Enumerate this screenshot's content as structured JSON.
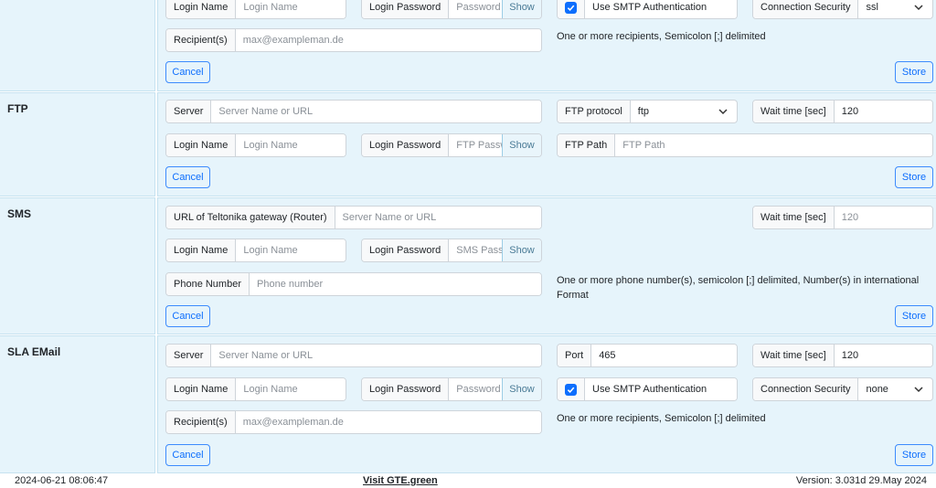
{
  "smtp": {
    "login_name": {
      "label": "Login Name",
      "placeholder": "Login Name"
    },
    "login_password": {
      "label": "Login Password",
      "placeholder": "Password",
      "show": "Show"
    },
    "auth": {
      "label": "Use SMTP Authentication",
      "checked": true
    },
    "security": {
      "label": "Connection Security",
      "value": "ssl"
    },
    "recipients": {
      "label": "Recipient(s)",
      "placeholder": "max@exampleman.de"
    },
    "hint": "One or more recipients, Semicolon [;] delimited",
    "cancel": "Cancel",
    "store": "Store"
  },
  "ftp": {
    "title": "FTP",
    "server": {
      "label": "Server",
      "placeholder": "Server Name or URL"
    },
    "protocol": {
      "label": "FTP protocol",
      "value": "ftp"
    },
    "wait": {
      "label": "Wait time [sec]",
      "value": "120"
    },
    "login_name": {
      "label": "Login Name",
      "placeholder": "Login Name"
    },
    "login_password": {
      "label": "Login Password",
      "placeholder": "FTP Passw",
      "show": "Show"
    },
    "path": {
      "label": "FTP Path",
      "placeholder": "FTP Path"
    },
    "cancel": "Cancel",
    "store": "Store"
  },
  "sms": {
    "title": "SMS",
    "gateway": {
      "label": "URL of Teltonika gateway (Router)",
      "placeholder": "Server Name or URL"
    },
    "wait": {
      "label": "Wait time [sec]",
      "placeholder": "120"
    },
    "login_name": {
      "label": "Login Name",
      "placeholder": "Login Name"
    },
    "login_password": {
      "label": "Login Password",
      "placeholder": "SMS Passv",
      "show": "Show"
    },
    "phone": {
      "label": "Phone Number",
      "placeholder": "Phone number"
    },
    "hint": "One or more phone number(s), semicolon [;] delimited, Number(s) in international Format",
    "cancel": "Cancel",
    "store": "Store"
  },
  "sla": {
    "title": "SLA EMail",
    "server": {
      "label": "Server",
      "placeholder": "Server Name or URL"
    },
    "port": {
      "label": "Port",
      "value": "465"
    },
    "wait": {
      "label": "Wait time [sec]",
      "value": "120"
    },
    "login_name": {
      "label": "Login Name",
      "placeholder": "Login Name"
    },
    "login_password": {
      "label": "Login Password",
      "placeholder": "Password",
      "show": "Show"
    },
    "auth": {
      "label": "Use SMTP Authentication",
      "checked": true
    },
    "security": {
      "label": "Connection Security",
      "value": "none"
    },
    "recipients": {
      "label": "Recipient(s)",
      "placeholder": "max@exampleman.de"
    },
    "hint": "One or more recipients, Semicolon [;] delimited",
    "cancel": "Cancel",
    "store": "Store"
  },
  "footer": {
    "datetime": "2024-06-21 08:06:47",
    "link": "Visit GTE.green",
    "version": "Version: 3.031d 29.May 2024"
  },
  "colors": {
    "panel_bg": "#e6f4fb",
    "accent": "#0d6efd"
  }
}
